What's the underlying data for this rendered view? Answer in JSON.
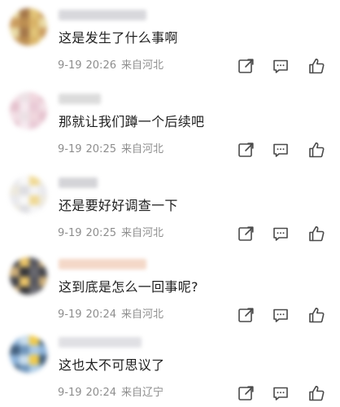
{
  "comments": [
    {
      "text": "这是发生了什么事啊",
      "date": "9-19",
      "time": "20:26",
      "location": "来自河北",
      "avatar_colors": [
        "#e8d8a0",
        "#d8b060",
        "#b88848",
        "#c89858",
        "#e0c070",
        "#a07040"
      ],
      "username_color": "#d8d8dc"
    },
    {
      "text": "那就让我们蹲一个后续吧",
      "date": "9-19",
      "time": "20:25",
      "location": "来自河北",
      "avatar_colors": [
        "#f2dde4",
        "#e8c8d4",
        "#f6e8ee",
        "#e4c0cc",
        "#f0d4dc",
        "#ece0e4"
      ],
      "username_color": "#dcdcdc"
    },
    {
      "text": "还是要好好调查一下",
      "date": "9-19",
      "time": "20:25",
      "location": "来自河北",
      "avatar_colors": [
        "#e8e8ec",
        "#f4f4f6",
        "#dcdce0",
        "#ece8dc",
        "#f0d890",
        "#f8f8f8"
      ],
      "username_color": "#d4d4d8"
    },
    {
      "text": "这到底是怎么一回事呢?",
      "date": "9-19",
      "time": "20:24",
      "location": "来自河北",
      "avatar_colors": [
        "#3a3a40",
        "#606068",
        "#2c2c30",
        "#c8a870",
        "#505058",
        "#e8c060"
      ],
      "username_color": "#f4d8c8"
    },
    {
      "text": "这也太不可思议了",
      "date": "9-19",
      "time": "20:24",
      "location": "来自辽宁",
      "avatar_colors": [
        "#88b0d8",
        "#a8c8e4",
        "#6890b8",
        "#3a5878",
        "#f0c840",
        "#c8dcec"
      ],
      "username_color": "#e0e0e4"
    }
  ],
  "icons": [
    "share-icon",
    "comment-icon",
    "like-icon"
  ],
  "colors": {
    "text": "#1f1f1f",
    "meta": "#8e8e8e",
    "icon": "#4a4a4a"
  }
}
